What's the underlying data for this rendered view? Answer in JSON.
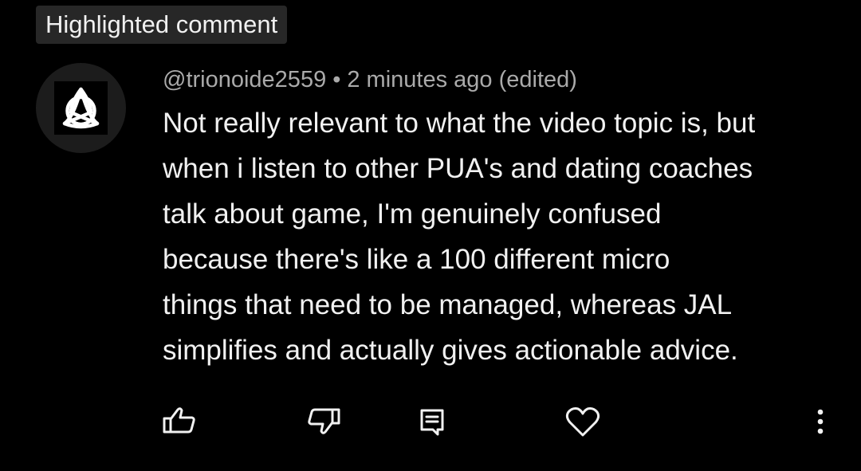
{
  "badge": {
    "label": "Highlighted comment"
  },
  "comment": {
    "author": "@trionoide2559",
    "separator": "•",
    "time": "2 minutes ago (edited)",
    "lines": [
      "Not really relevant to what the video topic is, but",
      "when i listen to other PUA's and dating coaches",
      "talk about game, I'm genuinely confused",
      "because there's like a 100 different micro",
      "things that need to be managed, whereas JAL",
      "simplifies and actually gives actionable advice."
    ]
  },
  "avatar": {
    "icon": "triquetra-icon"
  },
  "actions": {
    "items": [
      "like-icon",
      "dislike-icon",
      "reply-icon",
      "heart-icon",
      "more-vert-icon"
    ]
  },
  "colors": {
    "background": "#000000",
    "badge_background": "#272727",
    "primary_text": "#f1f1f1",
    "secondary_text": "#aaaaaa",
    "avatar_background": "#1c1c1c"
  }
}
